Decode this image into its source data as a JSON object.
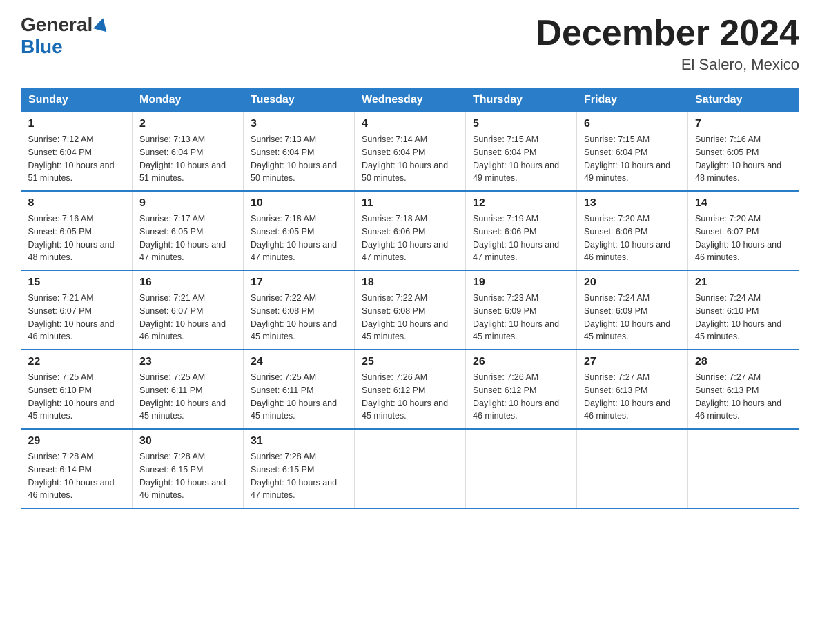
{
  "header": {
    "logo_general": "General",
    "logo_blue": "Blue",
    "month_title": "December 2024",
    "location": "El Salero, Mexico"
  },
  "days_of_week": [
    "Sunday",
    "Monday",
    "Tuesday",
    "Wednesday",
    "Thursday",
    "Friday",
    "Saturday"
  ],
  "weeks": [
    [
      {
        "day": "1",
        "sunrise": "7:12 AM",
        "sunset": "6:04 PM",
        "daylight": "10 hours and 51 minutes."
      },
      {
        "day": "2",
        "sunrise": "7:13 AM",
        "sunset": "6:04 PM",
        "daylight": "10 hours and 51 minutes."
      },
      {
        "day": "3",
        "sunrise": "7:13 AM",
        "sunset": "6:04 PM",
        "daylight": "10 hours and 50 minutes."
      },
      {
        "day": "4",
        "sunrise": "7:14 AM",
        "sunset": "6:04 PM",
        "daylight": "10 hours and 50 minutes."
      },
      {
        "day": "5",
        "sunrise": "7:15 AM",
        "sunset": "6:04 PM",
        "daylight": "10 hours and 49 minutes."
      },
      {
        "day": "6",
        "sunrise": "7:15 AM",
        "sunset": "6:04 PM",
        "daylight": "10 hours and 49 minutes."
      },
      {
        "day": "7",
        "sunrise": "7:16 AM",
        "sunset": "6:05 PM",
        "daylight": "10 hours and 48 minutes."
      }
    ],
    [
      {
        "day": "8",
        "sunrise": "7:16 AM",
        "sunset": "6:05 PM",
        "daylight": "10 hours and 48 minutes."
      },
      {
        "day": "9",
        "sunrise": "7:17 AM",
        "sunset": "6:05 PM",
        "daylight": "10 hours and 47 minutes."
      },
      {
        "day": "10",
        "sunrise": "7:18 AM",
        "sunset": "6:05 PM",
        "daylight": "10 hours and 47 minutes."
      },
      {
        "day": "11",
        "sunrise": "7:18 AM",
        "sunset": "6:06 PM",
        "daylight": "10 hours and 47 minutes."
      },
      {
        "day": "12",
        "sunrise": "7:19 AM",
        "sunset": "6:06 PM",
        "daylight": "10 hours and 47 minutes."
      },
      {
        "day": "13",
        "sunrise": "7:20 AM",
        "sunset": "6:06 PM",
        "daylight": "10 hours and 46 minutes."
      },
      {
        "day": "14",
        "sunrise": "7:20 AM",
        "sunset": "6:07 PM",
        "daylight": "10 hours and 46 minutes."
      }
    ],
    [
      {
        "day": "15",
        "sunrise": "7:21 AM",
        "sunset": "6:07 PM",
        "daylight": "10 hours and 46 minutes."
      },
      {
        "day": "16",
        "sunrise": "7:21 AM",
        "sunset": "6:07 PM",
        "daylight": "10 hours and 46 minutes."
      },
      {
        "day": "17",
        "sunrise": "7:22 AM",
        "sunset": "6:08 PM",
        "daylight": "10 hours and 45 minutes."
      },
      {
        "day": "18",
        "sunrise": "7:22 AM",
        "sunset": "6:08 PM",
        "daylight": "10 hours and 45 minutes."
      },
      {
        "day": "19",
        "sunrise": "7:23 AM",
        "sunset": "6:09 PM",
        "daylight": "10 hours and 45 minutes."
      },
      {
        "day": "20",
        "sunrise": "7:24 AM",
        "sunset": "6:09 PM",
        "daylight": "10 hours and 45 minutes."
      },
      {
        "day": "21",
        "sunrise": "7:24 AM",
        "sunset": "6:10 PM",
        "daylight": "10 hours and 45 minutes."
      }
    ],
    [
      {
        "day": "22",
        "sunrise": "7:25 AM",
        "sunset": "6:10 PM",
        "daylight": "10 hours and 45 minutes."
      },
      {
        "day": "23",
        "sunrise": "7:25 AM",
        "sunset": "6:11 PM",
        "daylight": "10 hours and 45 minutes."
      },
      {
        "day": "24",
        "sunrise": "7:25 AM",
        "sunset": "6:11 PM",
        "daylight": "10 hours and 45 minutes."
      },
      {
        "day": "25",
        "sunrise": "7:26 AM",
        "sunset": "6:12 PM",
        "daylight": "10 hours and 45 minutes."
      },
      {
        "day": "26",
        "sunrise": "7:26 AM",
        "sunset": "6:12 PM",
        "daylight": "10 hours and 46 minutes."
      },
      {
        "day": "27",
        "sunrise": "7:27 AM",
        "sunset": "6:13 PM",
        "daylight": "10 hours and 46 minutes."
      },
      {
        "day": "28",
        "sunrise": "7:27 AM",
        "sunset": "6:13 PM",
        "daylight": "10 hours and 46 minutes."
      }
    ],
    [
      {
        "day": "29",
        "sunrise": "7:28 AM",
        "sunset": "6:14 PM",
        "daylight": "10 hours and 46 minutes."
      },
      {
        "day": "30",
        "sunrise": "7:28 AM",
        "sunset": "6:15 PM",
        "daylight": "10 hours and 46 minutes."
      },
      {
        "day": "31",
        "sunrise": "7:28 AM",
        "sunset": "6:15 PM",
        "daylight": "10 hours and 47 minutes."
      },
      null,
      null,
      null,
      null
    ]
  ]
}
